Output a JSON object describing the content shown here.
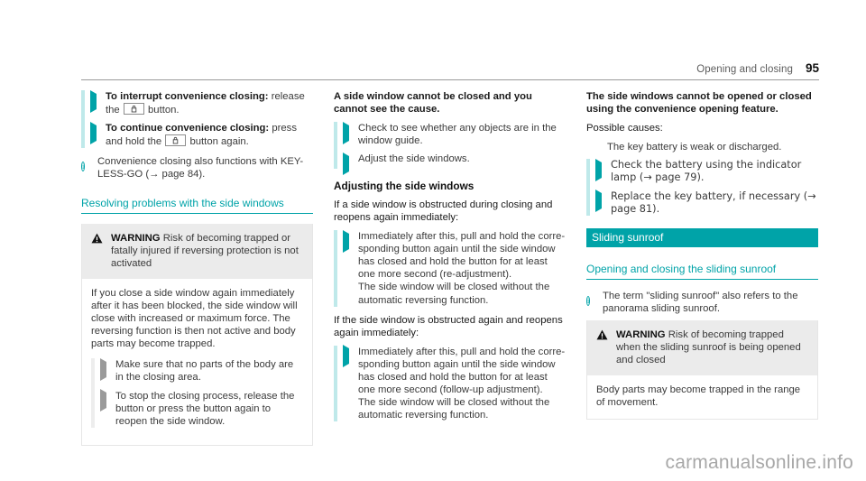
{
  "header": {
    "title": "Opening and closing",
    "page_number": "95"
  },
  "watermark": "carmanualsonline.info",
  "colors": {
    "accent_teal": "#00a3a8",
    "step_bar": "#bfe9ea",
    "warn_header_bg": "#ebebeb"
  },
  "col1": {
    "step_interrupt": {
      "label": "To interrupt convenience closing:",
      "text_before_key": " release the",
      "text_after_key": " button."
    },
    "step_continue": {
      "label": "To continue convenience closing:",
      "text_before_key": " press and hold the",
      "text_after_key": " button again."
    },
    "note": "Convenience closing also functions with KEY-LESS-GO (→ page 84).",
    "heading": "Resolving problems with the side windows",
    "warning": {
      "label": "WARNING",
      "title": " Risk of becoming trapped or fatally injured if reversing protection is not activated",
      "body": "If you close a side window again immediately after it has been blocked, the side window will close with increased or maximum force. The reversing function is then not active and body parts may become trapped.",
      "steps": [
        "Make sure that no parts of the body are in the closing area.",
        "To stop the closing process, release the button or press the button again to reopen the side window."
      ]
    }
  },
  "col2": {
    "intro": "A side window cannot be closed and you cannot see the cause.",
    "steps": [
      "Check to see whether any objects are in the window guide.",
      "Adjust the side windows."
    ],
    "subhead": "Adjusting the side windows",
    "block1": {
      "intro": "If a side window is obstructed during closing and reopens again immediately:",
      "step": "Immediately after this, pull and hold the corre-sponding button again until the side window has closed and hold the button for at least one more second (re-adjustment).",
      "step_sub": "The side window will be closed without the automatic reversing function."
    },
    "block2": {
      "intro": "If the side window is obstructed again and reopens again immediately:",
      "step": "Immediately after this, pull and hold the corre-sponding button again until the side window has closed and hold the button for at least one more second (follow-up adjustment).",
      "step_sub": "The side window will be closed without the automatic reversing function."
    }
  },
  "col3": {
    "intro": "The side windows cannot be opened or closed using the convenience opening feature.",
    "causes_label": "Possible causes:",
    "causes": [
      "The key battery is weak or discharged."
    ],
    "steps": [
      "Check the battery using the indicator lamp (→ page 79).",
      "Replace the key battery, if necessary (→ page 81)."
    ],
    "banner": "Sliding sunroof",
    "heading": "Opening and closing the sliding sunroof",
    "note": "The term \"sliding sunroof\" also refers to the panorama sliding sunroof.",
    "warning": {
      "label": "WARNING",
      "title": " Risk of becoming trapped when the sliding sunroof is being opened and closed",
      "body": "Body parts may become trapped in the range of movement."
    }
  }
}
